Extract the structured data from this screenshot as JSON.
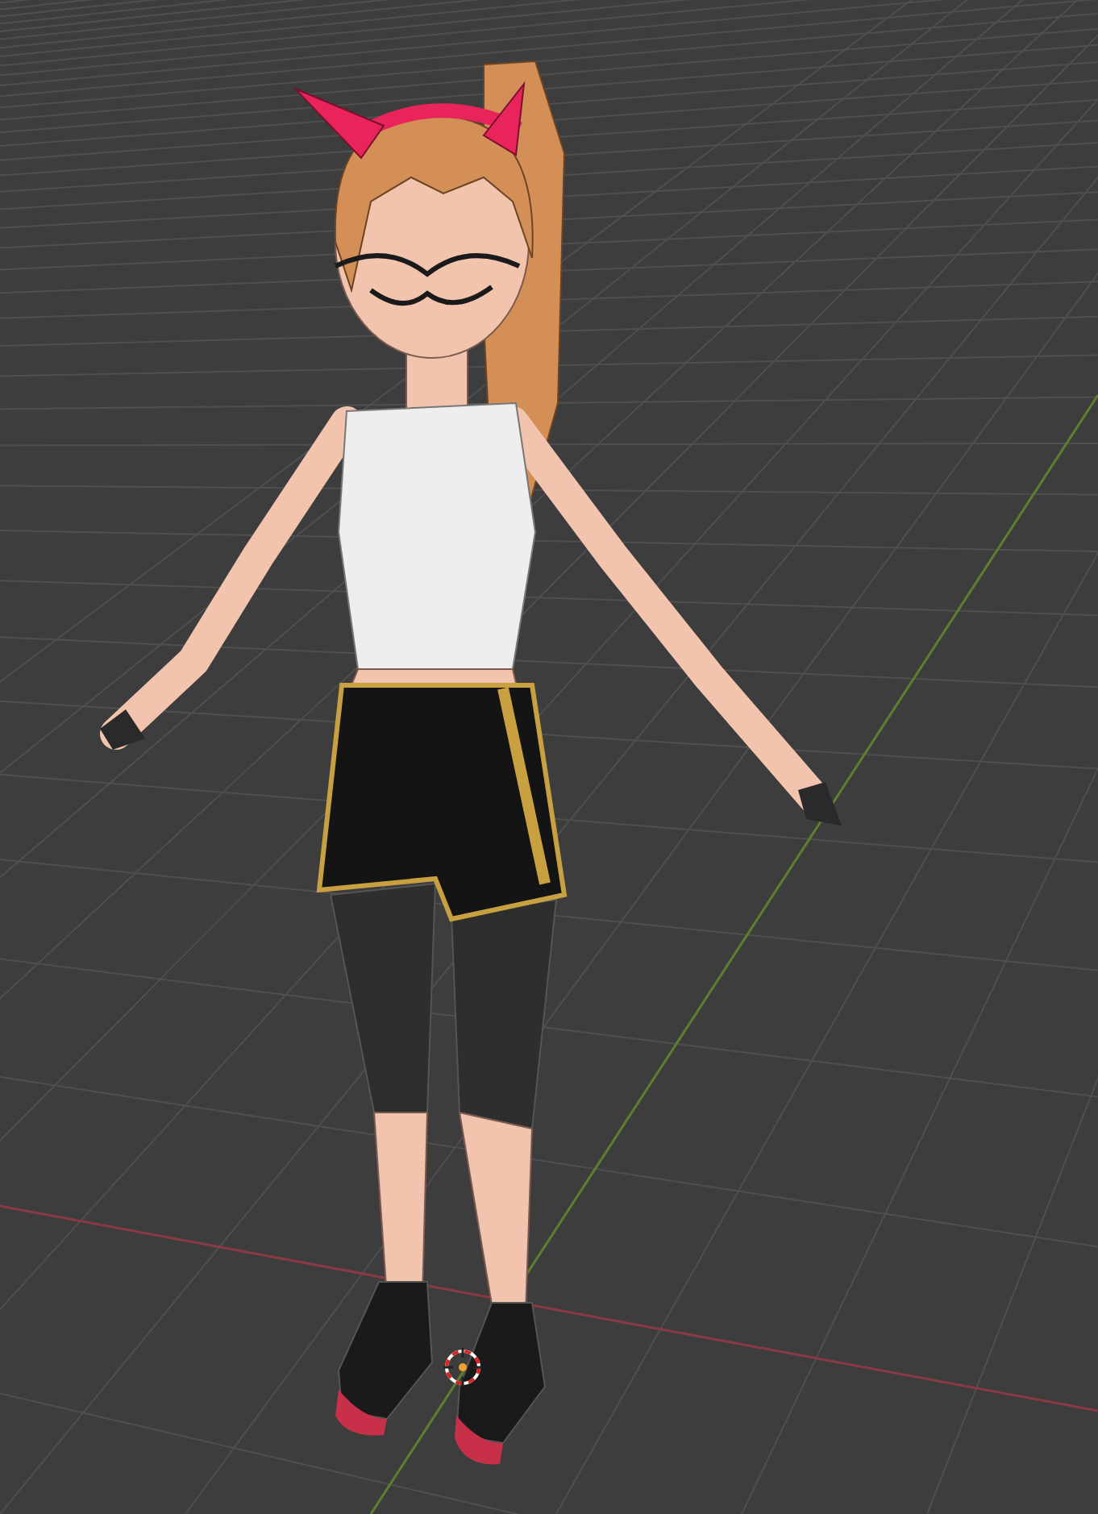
{
  "viewport": {
    "show_grid": true,
    "show_axes": true,
    "show_cursor": true,
    "show_model": true
  }
}
